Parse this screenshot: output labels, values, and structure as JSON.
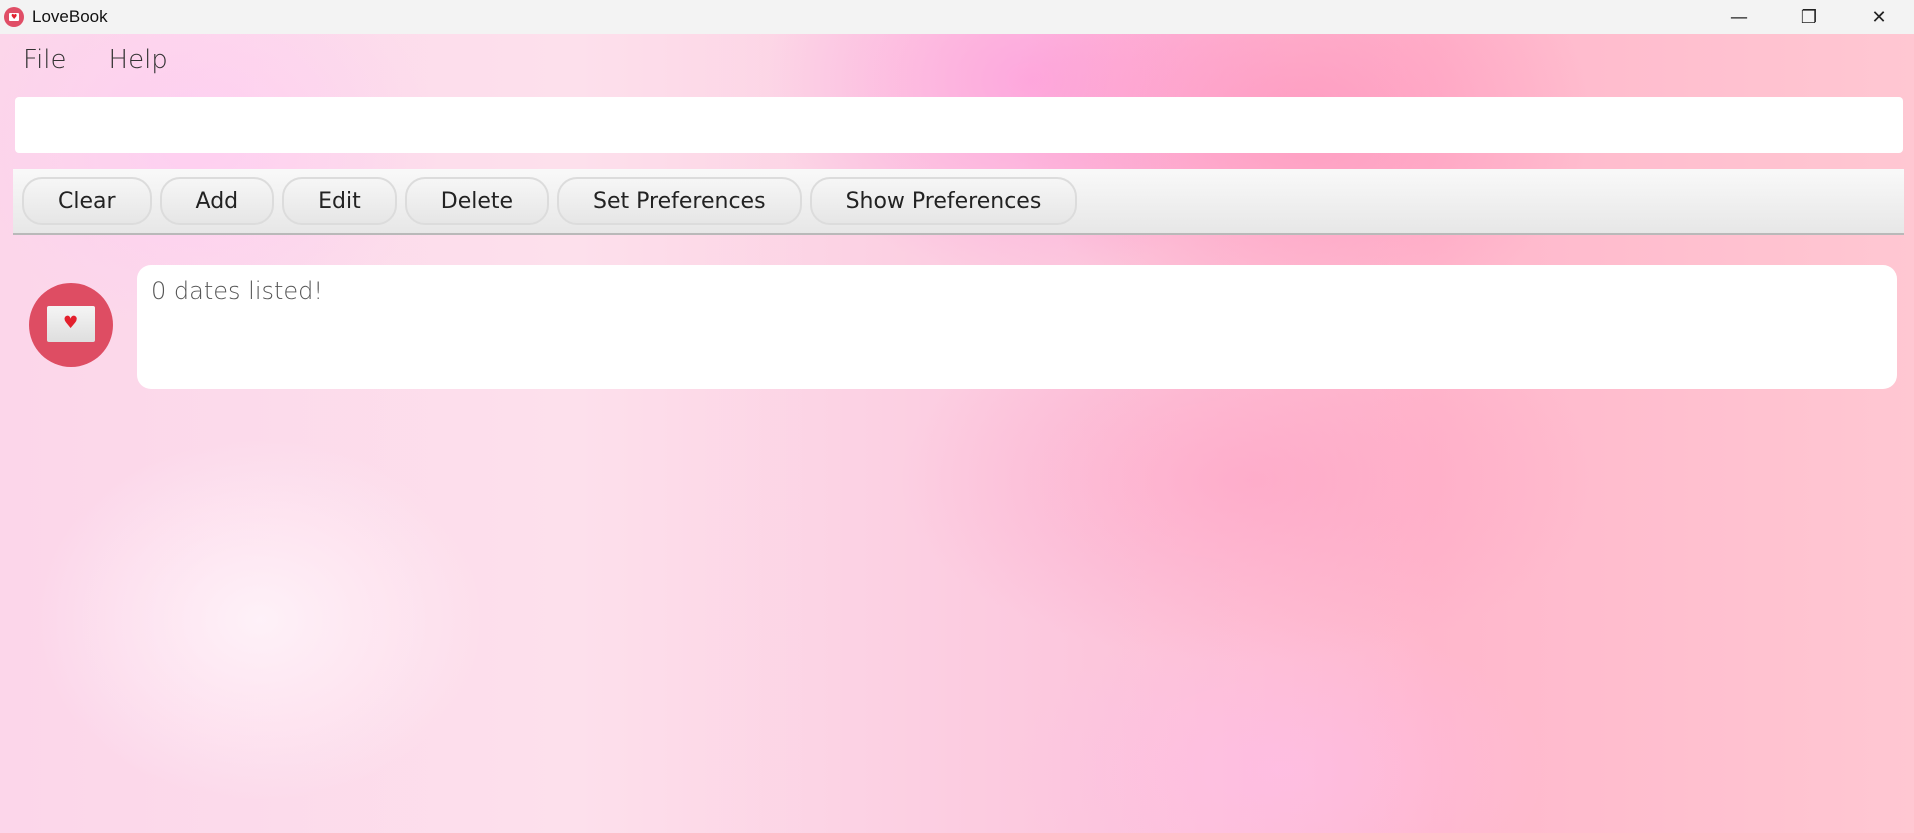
{
  "window": {
    "title": "LoveBook",
    "controls": {
      "minimize": "—",
      "restore": "❐",
      "close": "✕"
    }
  },
  "menu": {
    "file": "File",
    "help": "Help"
  },
  "command": {
    "value": "",
    "placeholder": ""
  },
  "toolbar": {
    "clear": "Clear",
    "add": "Add",
    "edit": "Edit",
    "delete": "Delete",
    "set_preferences": "Set Preferences",
    "show_preferences": "Show Preferences"
  },
  "result": {
    "message": "0 dates listed!",
    "icon": "envelope-heart-icon"
  },
  "colors": {
    "accent": "#de4d63",
    "heart": "#e3202d"
  }
}
